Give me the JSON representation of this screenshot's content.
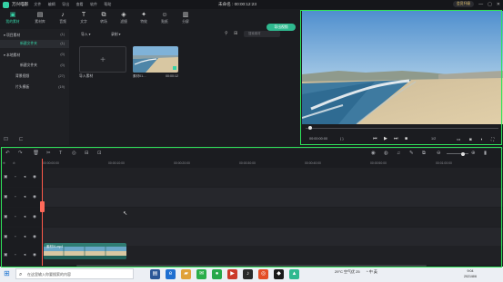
{
  "app": {
    "name": "万兴喵影",
    "menu": [
      "文件",
      "编辑",
      "导出",
      "查看",
      "软件",
      "帮助"
    ],
    "project_title": "未命名 : 00:00:12:23",
    "vip_label": "会员升级",
    "window_controls": [
      "—",
      "▢",
      "✕"
    ]
  },
  "media_tabs": [
    {
      "label": "我的素材",
      "icon": "▣"
    },
    {
      "label": "素材库",
      "icon": "▤"
    },
    {
      "label": "音频",
      "icon": "♪"
    },
    {
      "label": "文字",
      "icon": "T"
    },
    {
      "label": "转场",
      "icon": "⧉"
    },
    {
      "label": "滤镜",
      "icon": "◈"
    },
    {
      "label": "特效",
      "icon": "✦"
    },
    {
      "label": "贴纸",
      "icon": "☺"
    },
    {
      "label": "分屏",
      "icon": "▥"
    }
  ],
  "export_button": "导出视频",
  "tree": [
    {
      "label": "项目素材",
      "count": "(1)",
      "indent": 0,
      "selected": false,
      "arrow": "▾"
    },
    {
      "label": "新建文件夹",
      "count": "(1)",
      "indent": 1,
      "selected": true,
      "arrow": ""
    },
    {
      "label": "本地素材",
      "count": "(0)",
      "indent": 0,
      "selected": false,
      "arrow": "▾"
    },
    {
      "label": "新建文件夹",
      "count": "(0)",
      "indent": 1,
      "selected": false,
      "arrow": ""
    },
    {
      "label": "背景视频",
      "count": "(27)",
      "indent": 0,
      "selected": false,
      "arrow": ""
    },
    {
      "label": "片头模板",
      "count": "(19)",
      "indent": 0,
      "selected": false,
      "arrow": ""
    }
  ],
  "filter": {
    "import_dd": "导入 ▾",
    "record_dd": "录制 ▾",
    "search_placeholder": "搜索素材"
  },
  "tiles": {
    "import_label": "导入素材",
    "clip_label": "素材01…",
    "clip_duration": "00:00:12"
  },
  "preview": {
    "timecode": "00:00:00:00",
    "ratio": "1/2",
    "controls": [
      "⏮",
      "▶",
      "⏭",
      "■"
    ]
  },
  "ruler_labels": [
    "00:00:00:00",
    "00:00:10:00",
    "00:00:20:00",
    "00:00:30:00",
    "00:00:40:00",
    "00:00:50:00",
    "00:01:00:00"
  ],
  "audio_clip_label": "素材01.mp4",
  "taskbar": {
    "search_placeholder": "在这里输入你要搜索的内容",
    "weather": "29°C 空气优 25",
    "tray": "^ 中 英",
    "time": "9:04",
    "date": "2021/8/6"
  },
  "colors": {
    "accent": "#35d1a5",
    "highlight": "#2fe35a",
    "playhead": "#ff5a4a"
  }
}
